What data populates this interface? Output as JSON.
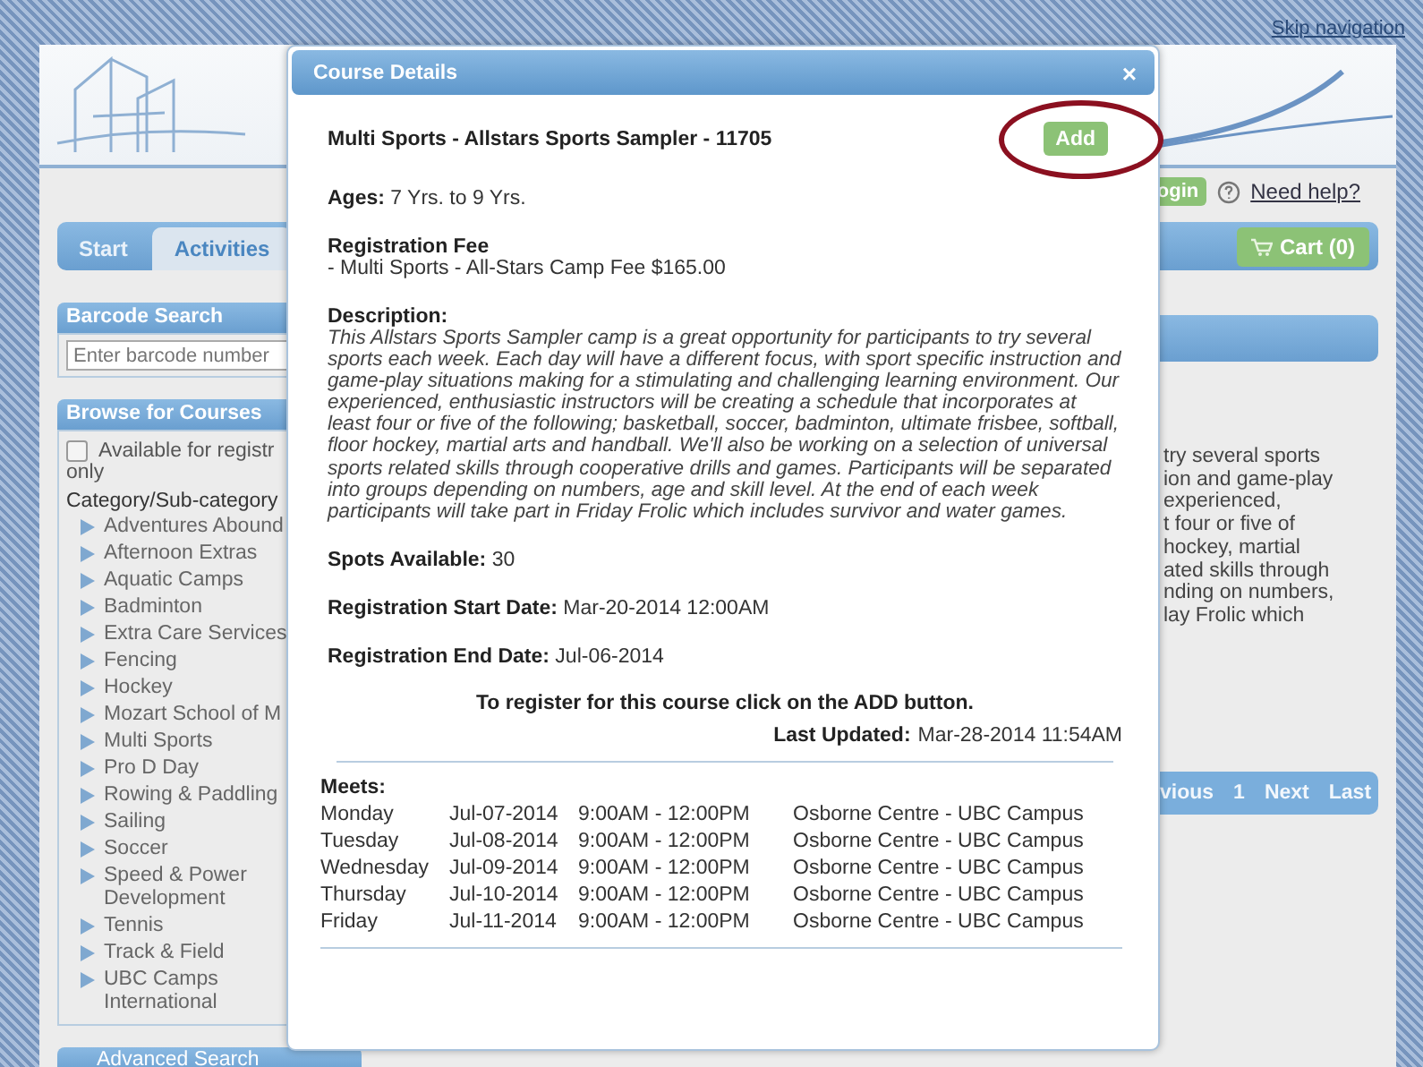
{
  "top_bar": {
    "skip_link": "Skip navigation"
  },
  "user_bar": {
    "login": "ogin",
    "help_link": "Need help?"
  },
  "nav": {
    "tabs": [
      {
        "label": "Start",
        "selected": false
      },
      {
        "label": "Activities",
        "selected": true
      }
    ],
    "cart": "Cart (0)"
  },
  "sidebar": {
    "barcode_search": {
      "title": "Barcode Search",
      "placeholder": "Enter barcode number"
    },
    "browse": {
      "title": "Browse for Courses",
      "available_filter": {
        "label": "Available for registr",
        "label_continued": "only",
        "checked": false
      },
      "category_label": "Category/Sub-category",
      "categories": [
        {
          "label": "Adventures Abound",
          "expanded": false
        },
        {
          "label": "Afternoon Extras",
          "expanded": false
        },
        {
          "label": "Aquatic Camps",
          "expanded": false
        },
        {
          "label": "Badminton",
          "expanded": false
        },
        {
          "label": "Extra Care Services",
          "expanded": false
        },
        {
          "label": "Fencing",
          "expanded": false
        },
        {
          "label": "Hockey",
          "expanded": false
        },
        {
          "label": "Mozart School of M",
          "expanded": false
        },
        {
          "label": "Multi Sports",
          "expanded": false
        },
        {
          "label": "Pro D Day",
          "expanded": false
        },
        {
          "label": "Rowing & Paddling",
          "expanded": false
        },
        {
          "label": "Sailing",
          "expanded": false
        },
        {
          "label": "Soccer",
          "expanded": false
        },
        {
          "label": "Speed & Power Development",
          "expanded": false
        },
        {
          "label": "Tennis",
          "expanded": false
        },
        {
          "label": "Track & Field",
          "expanded": false
        },
        {
          "label": "UBC Camps International",
          "expanded": false
        }
      ]
    },
    "advanced_search": "Advanced Search"
  },
  "main": {
    "description_fragments": [
      "try several sports",
      "ion and game-play",
      "experienced,",
      "t four or five of",
      "hockey, martial",
      "ated skills through",
      "nding on numbers,",
      "lay Frolic which"
    ],
    "pager": [
      "vious",
      "1",
      "Next",
      "Last"
    ]
  },
  "dialog": {
    "title": "Course Details",
    "close": "×",
    "course_name": "Multi Sports - Allstars Sports Sampler - 11705",
    "add_button": "Add",
    "ages": {
      "label": "Ages:",
      "value": "7 Yrs. to 9 Yrs."
    },
    "fee": {
      "label": "Registration Fee",
      "value": "- Multi Sports - All-Stars Camp Fee $165.00"
    },
    "description": {
      "label": "Description:",
      "text": "This Allstars Sports Sampler camp is a great opportunity for participants to try several sports each week. Each day will have a different focus, with sport specific instruction and game-play situations making for a stimulating and challenging learning environment. Our experienced, enthusiastic instructors will be creating a schedule that incorporates at least four or five of the following; basketball, soccer, badminton, ultimate frisbee, softball, floor hockey, martial arts and handball. We'll also be working on a selection of universal sports related skills through cooperative drills and games. Participants will be separated into groups depending on numbers, age and skill level. At the end of each week participants will take part in Friday Frolic which includes survivor and water games."
    },
    "spots": {
      "label": "Spots Available:",
      "value": "30"
    },
    "start_date": {
      "label": "Registration Start Date:",
      "value": "Mar-20-2014 12:00AM"
    },
    "end_date": {
      "label": "Registration End Date:",
      "value": "Jul-06-2014"
    },
    "register_note": "To register for this course click on the ADD button.",
    "last_updated": {
      "label": "Last Updated:",
      "value": "Mar-28-2014 11:54AM"
    },
    "meets_label": "Meets:",
    "meets": [
      {
        "day": "Monday",
        "date": "Jul-07-2014",
        "time": "9:00AM - 12:00PM",
        "location": "Osborne Centre - UBC Campus"
      },
      {
        "day": "Tuesday",
        "date": "Jul-08-2014",
        "time": "9:00AM - 12:00PM",
        "location": "Osborne Centre - UBC Campus"
      },
      {
        "day": "Wednesday",
        "date": "Jul-09-2014",
        "time": "9:00AM - 12:00PM",
        "location": "Osborne Centre - UBC Campus"
      },
      {
        "day": "Thursday",
        "date": "Jul-10-2014",
        "time": "9:00AM - 12:00PM",
        "location": "Osborne Centre - UBC Campus"
      },
      {
        "day": "Friday",
        "date": "Jul-11-2014",
        "time": "9:00AM - 12:00PM",
        "location": "Osborne Centre - UBC Campus"
      }
    ]
  }
}
